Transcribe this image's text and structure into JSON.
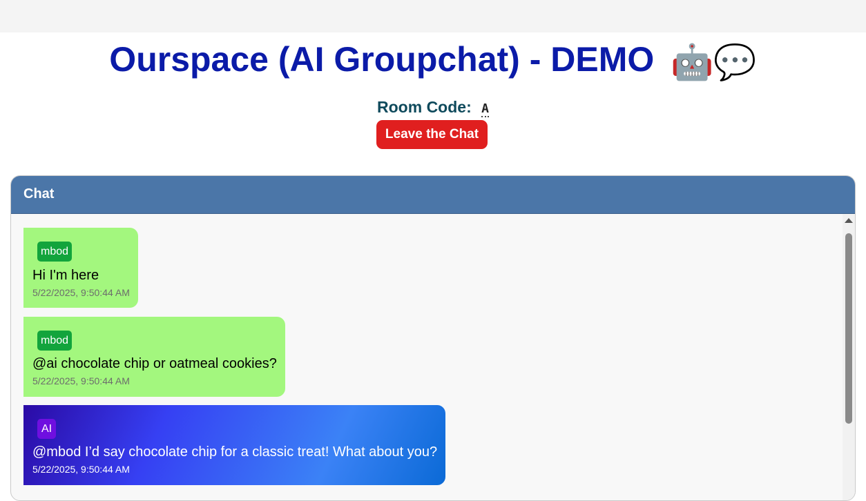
{
  "header": {
    "title": "Ourspace (AI Groupchat) - DEMO",
    "title_emoji": "🤖💬",
    "room_code_label": "Room Code:",
    "room_code_value": "A",
    "leave_button_label": "Leave the Chat"
  },
  "chat": {
    "panel_title": "Chat",
    "messages": [
      {
        "sender": "mbod",
        "text": "Hi I'm here",
        "timestamp": "5/22/2025, 9:50:44 AM",
        "kind": "human"
      },
      {
        "sender": "mbod",
        "text": "@ai chocolate chip or oatmeal cookies?",
        "timestamp": "5/22/2025, 9:50:44 AM",
        "kind": "human"
      },
      {
        "sender": "AI",
        "text": "@mbod I’d say chocolate chip for a classic treat! What about you?",
        "timestamp": "5/22/2025, 9:50:44 AM",
        "kind": "ai"
      }
    ]
  },
  "colors": {
    "title": "#0b1ba8",
    "leave_button": "#e01f1f",
    "chat_header": "#4b76a8",
    "human_bubble": "#a3f77e",
    "human_sender_badge": "#12a43c",
    "ai_sender_badge": "#6f0fe0"
  }
}
